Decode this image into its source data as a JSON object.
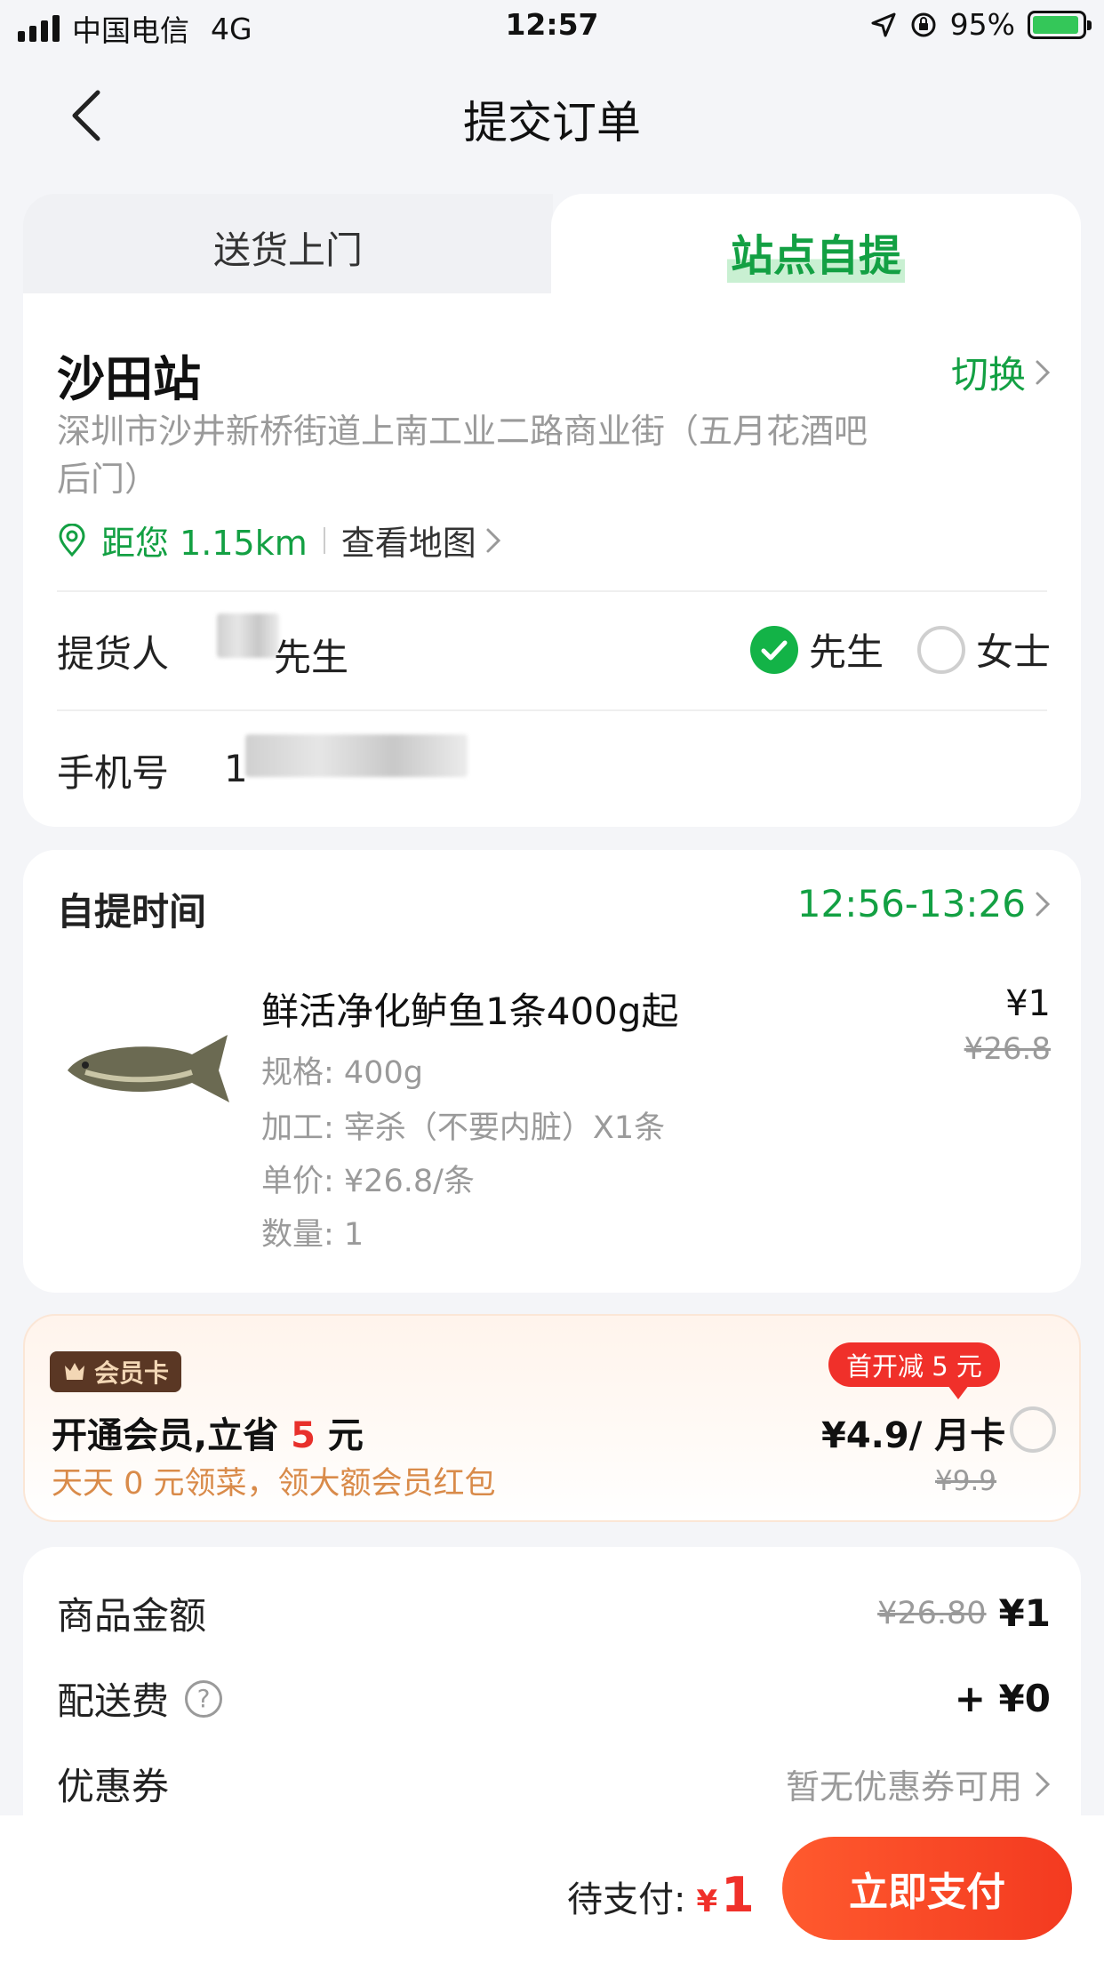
{
  "status_bar": {
    "carrier": "中国电信",
    "network": "4G",
    "time": "12:57",
    "battery": "95%"
  },
  "nav": {
    "title": "提交订单"
  },
  "tabs": [
    {
      "label": "送货上门",
      "active": false
    },
    {
      "label": "站点自提",
      "active": true
    }
  ],
  "station": {
    "name": "沙田站",
    "switch_label": "切换",
    "address": "深圳市沙井新桥街道上南工业二路商业街（五月花酒吧后门）",
    "distance": "距您 1.15km",
    "map_link": "查看地图"
  },
  "pickup_person": {
    "label": "提货人",
    "name_suffix": "先生",
    "options": [
      {
        "label": "先生",
        "selected": true
      },
      {
        "label": "女士",
        "selected": false
      }
    ]
  },
  "phone": {
    "label": "手机号",
    "prefix": "1"
  },
  "pickup_time": {
    "label": "自提时间",
    "value": "12:56-13:26"
  },
  "product": {
    "name": "鲜活净化鲈鱼1条400g起",
    "spec": "规格: 400g",
    "process": "加工: 宰杀（不要内脏）X1条",
    "unit_price": "单价: ¥26.8/条",
    "quantity": "数量: 1",
    "price": "¥1",
    "original_price": "¥26.8"
  },
  "member": {
    "badge": "会员卡",
    "title_prefix": "开通会员,立省 ",
    "title_amount": "5",
    "title_suffix": " 元",
    "subtitle": "天天 0 元领菜，领大额会员红包",
    "promo_tag": "首开减 5 元",
    "price": "¥4.9/ 月卡",
    "original_price": "¥9.9",
    "selected": false
  },
  "summary": {
    "goods_label": "商品金额",
    "goods_original": "¥26.80",
    "goods_amount": "¥1",
    "delivery_label": "配送费",
    "delivery_help": "?",
    "delivery_amount": "+ ¥0",
    "coupon_label": "优惠券",
    "coupon_value": "暂无优惠券可用"
  },
  "footer": {
    "to_pay_label": "待支付:",
    "currency": "¥",
    "to_pay_amount": "1",
    "pay_button": "立即支付"
  },
  "colors": {
    "brand_green": "#13a043",
    "pay_red": "#f0302a",
    "member_orange": "#d98b4a"
  }
}
